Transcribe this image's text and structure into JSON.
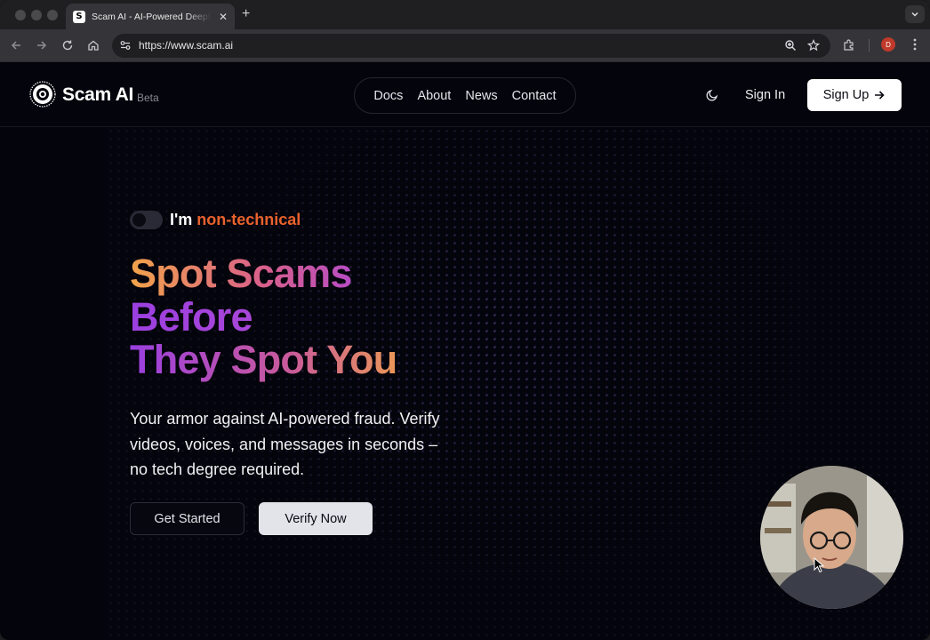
{
  "browser": {
    "tab_title": "Scam AI - AI-Powered Deepfake",
    "favicon_letter": "S",
    "url": "https://www.scam.ai",
    "profile_initial": "D"
  },
  "header": {
    "brand": "Scam AI",
    "badge": "Beta",
    "nav": [
      "Docs",
      "About",
      "News",
      "Contact"
    ],
    "sign_in": "Sign In",
    "sign_up": "Sign Up"
  },
  "hero": {
    "toggle_prefix": "I'm",
    "toggle_accent": "non-technical",
    "toggle_on": false,
    "title_lines": [
      "Spot Scams",
      "Before",
      "They Spot You"
    ],
    "subtitle": "Your armor against AI-powered fraud. Verify videos, voices, and messages in seconds – no tech degree required.",
    "primary_cta": "Get Started",
    "secondary_cta": "Verify Now"
  },
  "colors": {
    "accent_orange": "#e8622d",
    "gradient_orange": "#f2a34a",
    "gradient_purple": "#9c3fe0",
    "background": "#04040c"
  }
}
